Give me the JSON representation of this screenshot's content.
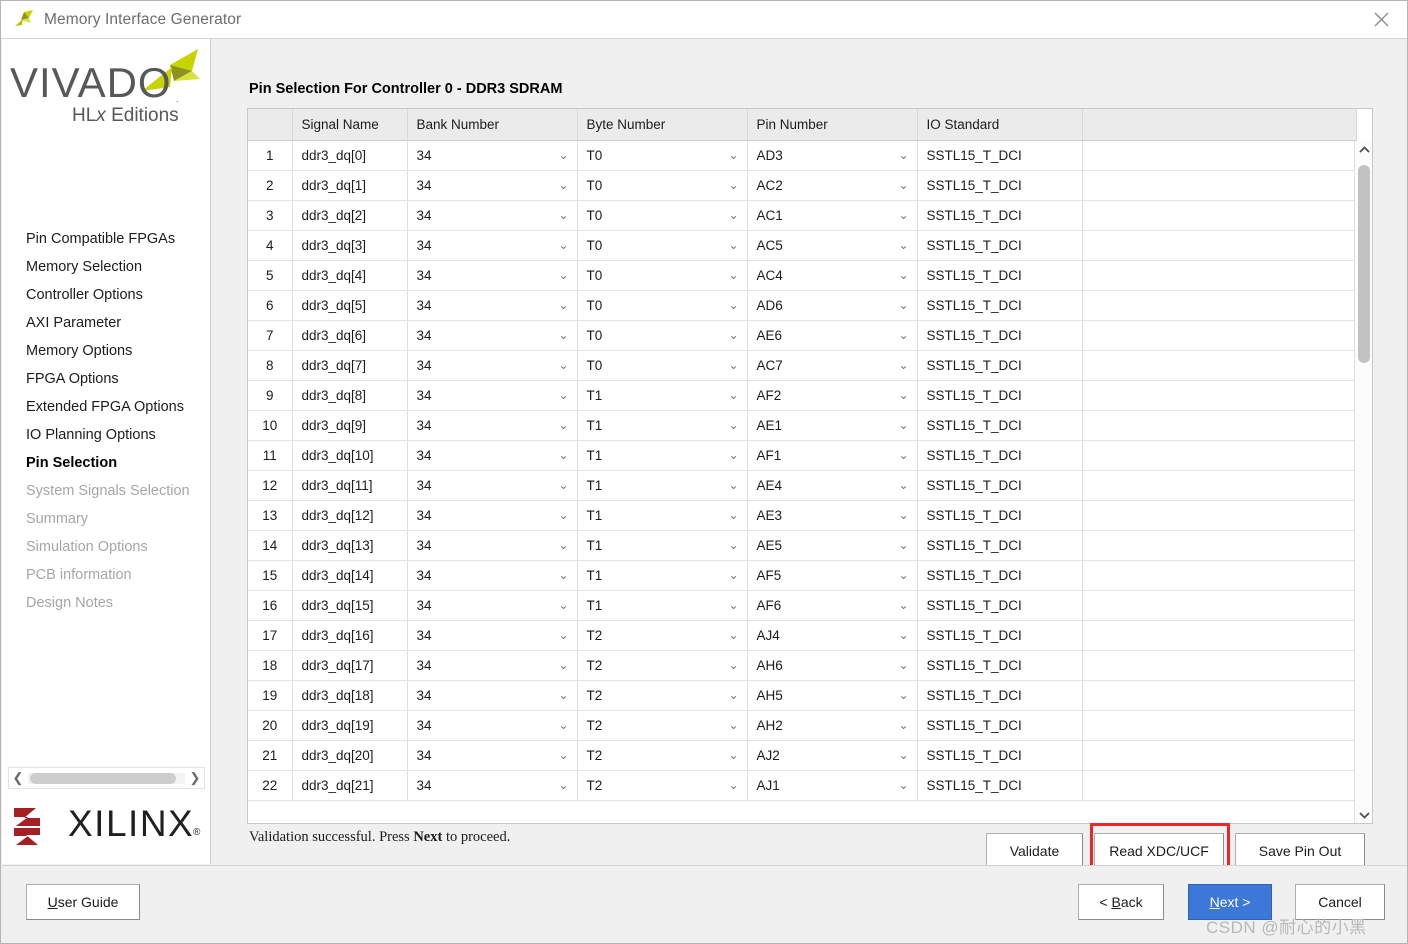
{
  "window": {
    "title": "Memory Interface Generator",
    "icon": "vivado-pinwheel-icon",
    "close_icon": "close-icon"
  },
  "branding": {
    "vivado_word": "VIVADO",
    "vivado_reg": ".",
    "vivado_sub_pre": "HL",
    "vivado_sub_it": "x",
    "vivado_sub_post": " Editions",
    "xilinx_word": "XILINX",
    "xilinx_reg": "®",
    "accent_green": "#c8d400",
    "accent_olive": "#8f921f",
    "xilinx_red": "#a51f23"
  },
  "sidebar": {
    "items": [
      {
        "label": "Pin Compatible FPGAs",
        "state": "normal"
      },
      {
        "label": "Memory Selection",
        "state": "normal"
      },
      {
        "label": "Controller Options",
        "state": "normal"
      },
      {
        "label": "AXI Parameter",
        "state": "normal"
      },
      {
        "label": "Memory Options",
        "state": "normal"
      },
      {
        "label": "FPGA Options",
        "state": "normal"
      },
      {
        "label": "Extended FPGA Options",
        "state": "normal"
      },
      {
        "label": "IO Planning Options",
        "state": "normal"
      },
      {
        "label": "Pin Selection",
        "state": "active"
      },
      {
        "label": "System Signals Selection",
        "state": "disabled"
      },
      {
        "label": "Summary",
        "state": "disabled"
      },
      {
        "label": "Simulation Options",
        "state": "disabled"
      },
      {
        "label": "PCB information",
        "state": "disabled"
      },
      {
        "label": "Design Notes",
        "state": "disabled"
      }
    ]
  },
  "main": {
    "page_title": "Pin Selection For Controller 0 - DDR3 SDRAM",
    "table": {
      "columns": [
        "",
        "Signal Name",
        "Bank Number",
        "Byte Number",
        "Pin Number",
        "IO Standard",
        ""
      ],
      "rows": [
        {
          "index": "1",
          "signal": "ddr3_dq[0]",
          "bank": "34",
          "byte": "T0",
          "pin": "AD3",
          "io": "SSTL15_T_DCI"
        },
        {
          "index": "2",
          "signal": "ddr3_dq[1]",
          "bank": "34",
          "byte": "T0",
          "pin": "AC2",
          "io": "SSTL15_T_DCI"
        },
        {
          "index": "3",
          "signal": "ddr3_dq[2]",
          "bank": "34",
          "byte": "T0",
          "pin": "AC1",
          "io": "SSTL15_T_DCI"
        },
        {
          "index": "4",
          "signal": "ddr3_dq[3]",
          "bank": "34",
          "byte": "T0",
          "pin": "AC5",
          "io": "SSTL15_T_DCI"
        },
        {
          "index": "5",
          "signal": "ddr3_dq[4]",
          "bank": "34",
          "byte": "T0",
          "pin": "AC4",
          "io": "SSTL15_T_DCI"
        },
        {
          "index": "6",
          "signal": "ddr3_dq[5]",
          "bank": "34",
          "byte": "T0",
          "pin": "AD6",
          "io": "SSTL15_T_DCI"
        },
        {
          "index": "7",
          "signal": "ddr3_dq[6]",
          "bank": "34",
          "byte": "T0",
          "pin": "AE6",
          "io": "SSTL15_T_DCI"
        },
        {
          "index": "8",
          "signal": "ddr3_dq[7]",
          "bank": "34",
          "byte": "T0",
          "pin": "AC7",
          "io": "SSTL15_T_DCI"
        },
        {
          "index": "9",
          "signal": "ddr3_dq[8]",
          "bank": "34",
          "byte": "T1",
          "pin": "AF2",
          "io": "SSTL15_T_DCI"
        },
        {
          "index": "10",
          "signal": "ddr3_dq[9]",
          "bank": "34",
          "byte": "T1",
          "pin": "AE1",
          "io": "SSTL15_T_DCI"
        },
        {
          "index": "11",
          "signal": "ddr3_dq[10]",
          "bank": "34",
          "byte": "T1",
          "pin": "AF1",
          "io": "SSTL15_T_DCI"
        },
        {
          "index": "12",
          "signal": "ddr3_dq[11]",
          "bank": "34",
          "byte": "T1",
          "pin": "AE4",
          "io": "SSTL15_T_DCI"
        },
        {
          "index": "13",
          "signal": "ddr3_dq[12]",
          "bank": "34",
          "byte": "T1",
          "pin": "AE3",
          "io": "SSTL15_T_DCI"
        },
        {
          "index": "14",
          "signal": "ddr3_dq[13]",
          "bank": "34",
          "byte": "T1",
          "pin": "AE5",
          "io": "SSTL15_T_DCI"
        },
        {
          "index": "15",
          "signal": "ddr3_dq[14]",
          "bank": "34",
          "byte": "T1",
          "pin": "AF5",
          "io": "SSTL15_T_DCI"
        },
        {
          "index": "16",
          "signal": "ddr3_dq[15]",
          "bank": "34",
          "byte": "T1",
          "pin": "AF6",
          "io": "SSTL15_T_DCI"
        },
        {
          "index": "17",
          "signal": "ddr3_dq[16]",
          "bank": "34",
          "byte": "T2",
          "pin": "AJ4",
          "io": "SSTL15_T_DCI"
        },
        {
          "index": "18",
          "signal": "ddr3_dq[17]",
          "bank": "34",
          "byte": "T2",
          "pin": "AH6",
          "io": "SSTL15_T_DCI"
        },
        {
          "index": "19",
          "signal": "ddr3_dq[18]",
          "bank": "34",
          "byte": "T2",
          "pin": "AH5",
          "io": "SSTL15_T_DCI"
        },
        {
          "index": "20",
          "signal": "ddr3_dq[19]",
          "bank": "34",
          "byte": "T2",
          "pin": "AH2",
          "io": "SSTL15_T_DCI"
        },
        {
          "index": "21",
          "signal": "ddr3_dq[20]",
          "bank": "34",
          "byte": "T2",
          "pin": "AJ2",
          "io": "SSTL15_T_DCI"
        },
        {
          "index": "22",
          "signal": "ddr3_dq[21]",
          "bank": "34",
          "byte": "T2",
          "pin": "AJ1",
          "io": "SSTL15_T_DCI"
        }
      ]
    },
    "status": {
      "prefix": "Validation successful. Press ",
      "bold": "Next",
      "suffix": " to proceed."
    },
    "actions": {
      "validate": "Validate",
      "read_xdc": "Read XDC/UCF",
      "save_pin_out": "Save Pin Out",
      "highlight_color": "#ef2626"
    }
  },
  "footer": {
    "user_guide": "User Guide",
    "user_guide_mn": "U",
    "user_guide_rest": "ser Guide",
    "back_pre": "< ",
    "back_mn": "B",
    "back_rest": "ack",
    "next_mn": "N",
    "next_rest": "ext >",
    "cancel": "Cancel",
    "next_bg": "#3b78d8"
  },
  "watermark": "CSDN @耐心的小黑"
}
